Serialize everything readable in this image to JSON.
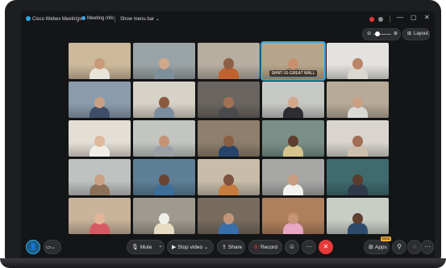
{
  "header": {
    "app_title": "Cisco Webex Meetings",
    "meeting_info_label": "Meeting Info",
    "menu_bar_label": "Show menu bar",
    "layout_label": "Layout",
    "window_controls": [
      "—",
      "▢",
      "✕"
    ]
  },
  "grid": {
    "tiles": [
      {
        "bg": "#cdb99a",
        "skin": "#c89a78",
        "shirt": "#e9e4da"
      },
      {
        "bg": "#9aa3a5",
        "skin": "#d0a88a",
        "shirt": "#7d8f9a"
      },
      {
        "bg": "#b6ae9f",
        "skin": "#8d5f45",
        "shirt": "#c0612f"
      },
      {
        "bg": "#b6a58c",
        "skin": "#c8916e",
        "shirt": "#8a7a68",
        "label": "SHNT-16-GREAT WALL",
        "highlight": true
      },
      {
        "bg": "#e4e2de",
        "skin": "#b88568",
        "shirt": "#dcd7cf"
      },
      {
        "bg": "#8a9cac",
        "skin": "#c99f82",
        "shirt": "#3f4e68"
      },
      {
        "bg": "#d7d2c8",
        "skin": "#8a5a3f",
        "shirt": "#7a8e9e"
      },
      {
        "bg": "#6a6560",
        "skin": "#a37055",
        "shirt": "#4a4a4d"
      },
      {
        "bg": "#c6c8c4",
        "skin": "#d2a78a",
        "shirt": "#2d2e34"
      },
      {
        "bg": "#b7aa98",
        "skin": "#caa083",
        "shirt": "#d9d9d6"
      },
      {
        "bg": "#e4dfd6",
        "skin": "#e0b89c",
        "shirt": "#f1eee8"
      },
      {
        "bg": "#c2c5c1",
        "skin": "#c49376",
        "shirt": "#9aa0a6"
      },
      {
        "bg": "#8f7f6d",
        "skin": "#8a5e44",
        "shirt": "#27456b"
      },
      {
        "bg": "#7a8f88",
        "skin": "#5f3f2f",
        "shirt": "#d6c48d"
      },
      {
        "bg": "#d9d5ce",
        "skin": "#a06e55",
        "shirt": "#cdbfae"
      },
      {
        "bg": "#bfc2c0",
        "skin": "#caa086",
        "shirt": "#8a7157"
      },
      {
        "bg": "#5e7f96",
        "skin": "#6a4532",
        "shirt": "#3b6f9a"
      },
      {
        "bg": "#c7bda9",
        "skin": "#7c5340",
        "shirt": "#c67c3f"
      },
      {
        "bg": "#a7a8a6",
        "skin": "#c89c80",
        "shirt": "#f2f2f0"
      },
      {
        "bg": "#3f6a6e",
        "skin": "#5a3c2f",
        "shirt": "#2e3a4a"
      },
      {
        "bg": "#c9b39a",
        "skin": "#e2b598",
        "shirt": "#d65a63"
      },
      {
        "bg": "#9f9a8f",
        "skin": "#f0f0ea",
        "shirt": "#e8dcc2"
      },
      {
        "bg": "#776b5e",
        "skin": "#c2957a",
        "shirt": "#3a6ea8"
      },
      {
        "bg": "#b0805c",
        "skin": "#c89275",
        "shirt": "#e6a6c4"
      },
      {
        "bg": "#c8cdc5",
        "skin": "#5f4030",
        "shirt": "#2d4a6c"
      }
    ]
  },
  "toolbar": {
    "mute_label": "Mute",
    "stop_video_label": "Stop video",
    "share_label": "Share",
    "record_label": "Record",
    "apps_label": "Apps",
    "beta_label": "Beta",
    "more_label": "···"
  },
  "colors": {
    "accent": "#2aa7e0",
    "end_call": "#e8393b",
    "record": "#e8393b",
    "beta": "#f2a93b"
  }
}
